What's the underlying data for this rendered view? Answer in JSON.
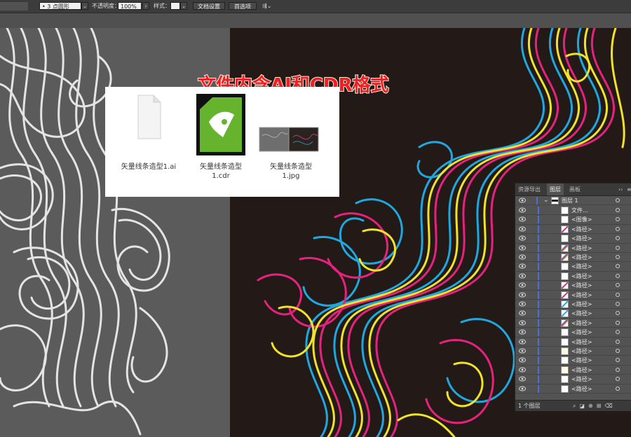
{
  "control_bar": {
    "brush_value": "3 点圆形",
    "opacity_label": "不透明度：",
    "opacity_value": "100%",
    "style_label": "样式：",
    "doc_setup_label": "文档设置",
    "prefs_label": "首选项"
  },
  "banner": {
    "text": "文件内含AI和CDR格式"
  },
  "files": [
    {
      "name": "矢量线条造型1.ai",
      "icon": "generic-file-icon"
    },
    {
      "name": "矢量线条造型\n1.cdr",
      "icon": "coreldraw-file-icon"
    },
    {
      "name": "矢量线条造型\n1.jpg",
      "icon": "image-thumbnail-icon"
    }
  ],
  "layers_panel": {
    "tabs": [
      "资源导出",
      "图层",
      "画板"
    ],
    "active_tab": "图层",
    "layer_name": "图层 1",
    "rows": [
      "文件...",
      "<图像>",
      "<路径>",
      "<路径>",
      "<路径>",
      "<路径>",
      "<路径>",
      "<路径>",
      "<路径>",
      "<路径>",
      "<路径>",
      "<路径>",
      "<路径>",
      "<路径>",
      "<路径>",
      "<路径>",
      "<路径>",
      "<路径>",
      "<路径>",
      "<路径>"
    ],
    "footer_count": "1 个图层",
    "colors": {
      "visibility_bar": "#4a6fd8",
      "highlight": "#4a6fd8"
    }
  },
  "colors": {
    "banner_text": "#f21d23",
    "line_cyan": "#1fa8df",
    "line_magenta": "#e5237c",
    "line_yellow": "#f1e22a",
    "artboard_bg": "#231a18",
    "gray_bg": "#5b5b5b"
  }
}
